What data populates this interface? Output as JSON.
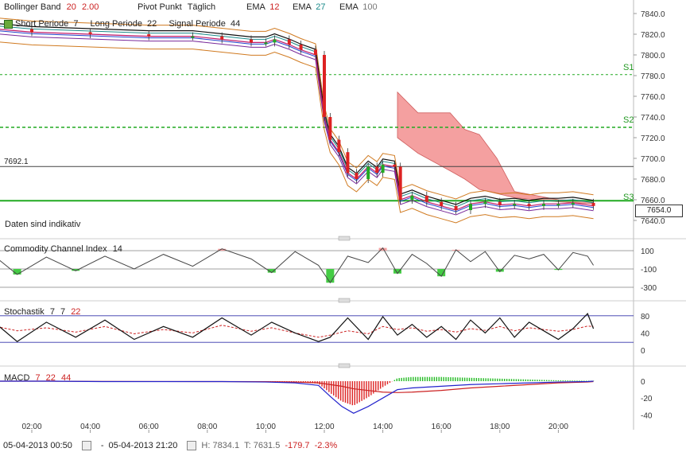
{
  "legend": {
    "bollinger": {
      "label": "Bollinger Band",
      "p1": "20",
      "p2": "2.00"
    },
    "pivot": {
      "label": "Pivot Punkt",
      "mode": "Täglich"
    },
    "ema": [
      {
        "label": "EMA",
        "value": "12"
      },
      {
        "label": "EMA",
        "value": "27"
      },
      {
        "label": "EMA",
        "value": "100"
      }
    ],
    "ichimoku": {
      "short_label": "Short Periode",
      "short_value": "7",
      "long_label": "Long Periode",
      "long_value": "22",
      "signal_label": "Signal Periode",
      "signal_value": "44"
    }
  },
  "main": {
    "note": "Daten sind indikativ",
    "level_label": "7692.1",
    "current_price": "7654.0",
    "pivot_labels": {
      "s1": "S1",
      "s2": "S2",
      "s3": "S3"
    }
  },
  "panels": {
    "cci": {
      "label": "Commodity Channel Index",
      "period": "14",
      "ticks": [
        "100",
        "-100",
        "-300"
      ]
    },
    "stoch": {
      "label": "Stochastik",
      "k": "7",
      "d": "7",
      "slow": "22",
      "ticks": [
        "80",
        "40",
        "0"
      ]
    },
    "macd": {
      "label": "MACD",
      "fast": "7",
      "slow": "22",
      "signal": "44",
      "ticks": [
        "0",
        "-20",
        "-40"
      ]
    }
  },
  "footer": {
    "start": "05-04-2013 00:50",
    "sep": "-",
    "end": "05-04-2013 21:20",
    "high": "H: 7834.1",
    "low": "T: 7631.5",
    "change": "-179.7",
    "change_pct": "-2.3%"
  },
  "colors": {
    "candle_up": "#22aa22",
    "candle_down": "#dd2222",
    "cloud": "#f08080",
    "pivot_line": "#22aa22",
    "cci_pos": "#f4a0a0",
    "cci_neg": "#44cc44",
    "macd_line": "#2222cc",
    "signal_line": "#cc2222"
  },
  "chart_data": [
    {
      "type": "line",
      "title": "",
      "x_tick_labels": [
        "02:00",
        "04:00",
        "06:00",
        "08:00",
        "10:00",
        "12:00",
        "14:00",
        "16:00",
        "18:00",
        "20:00"
      ],
      "x_tick_hours": [
        2,
        4,
        6,
        8,
        10,
        12,
        14,
        16,
        18,
        20
      ],
      "y_tick_labels": [
        "7840.0",
        "7820.0",
        "7800.0",
        "7780.0",
        "7760.0",
        "7740.0",
        "7720.0",
        "7700.0",
        "7680.0",
        "7660.0",
        "7640.0"
      ],
      "ylim": [
        7630,
        7850
      ],
      "reference_lines": {
        "S1": 7781,
        "S2": 7730,
        "S3": 7659,
        "level": 7692.1
      },
      "price_series": {
        "name": "",
        "x_hours": [
          0.8,
          2,
          4,
          6,
          7.5,
          8.5,
          9.5,
          10,
          10.3,
          10.8,
          11.2,
          11.7,
          12.0,
          12.2,
          12.5,
          12.8,
          13.1,
          13.5,
          13.8,
          14.0,
          14.4,
          14.6,
          15.0,
          15.5,
          16.0,
          16.5,
          17.0,
          17.5,
          18.0,
          18.5,
          19.0,
          19.5,
          20.0,
          20.5,
          21.2
        ],
        "values": [
          7825,
          7822,
          7820,
          7818,
          7818,
          7815,
          7812,
          7812,
          7815,
          7810,
          7805,
          7800,
          7740,
          7718,
          7706,
          7686,
          7680,
          7692,
          7686,
          7694,
          7692,
          7660,
          7664,
          7658,
          7654,
          7650,
          7656,
          7658,
          7655,
          7656,
          7654,
          7656,
          7656,
          7657,
          7654
        ]
      },
      "cloud": {
        "x_hours": [
          14.5,
          15.2,
          16.3,
          16.8,
          17.3,
          17.9,
          18.5,
          20.0,
          21.2
        ],
        "upper": [
          7764,
          7744,
          7744,
          7728,
          7723,
          7700,
          7668,
          7660,
          7659
        ],
        "lower": [
          7720,
          7705,
          7688,
          7680,
          7670,
          7666,
          7662,
          7658,
          7656
        ]
      }
    },
    {
      "type": "line",
      "title": "Commodity Channel Index 14",
      "y_tick_labels": [
        "100",
        "-100",
        "-300"
      ],
      "ylim": [
        -350,
        180
      ],
      "x_hours": [
        0.8,
        1.5,
        2.5,
        3.5,
        4.5,
        5.5,
        6.5,
        7.5,
        8.5,
        9.5,
        10.2,
        11.0,
        11.8,
        12.2,
        12.8,
        13.5,
        14.0,
        14.5,
        15.0,
        15.5,
        16.0,
        16.5,
        17.0,
        17.5,
        18.0,
        18.5,
        19.0,
        19.5,
        20.0,
        20.5,
        21.0,
        21.2
      ],
      "values": [
        20,
        -160,
        30,
        -120,
        40,
        -100,
        60,
        -70,
        120,
        10,
        -140,
        90,
        -60,
        -250,
        40,
        -30,
        130,
        -150,
        60,
        -40,
        -180,
        110,
        -20,
        90,
        -130,
        50,
        10,
        60,
        -110,
        80,
        40,
        -60
      ]
    },
    {
      "type": "line",
      "title": "Stochastik 7 7 22",
      "y_tick_labels": [
        "80",
        "40",
        "0"
      ],
      "ylim": [
        0,
        90
      ],
      "x_hours": [
        0.8,
        1.5,
        2.5,
        3.5,
        4.5,
        5.5,
        6.5,
        7.5,
        8.5,
        9.5,
        10.2,
        11.0,
        11.8,
        12.2,
        12.8,
        13.5,
        14.0,
        14.5,
        15.0,
        15.5,
        16.0,
        16.5,
        17.0,
        17.5,
        18.0,
        18.5,
        19.0,
        19.5,
        20.0,
        20.5,
        21.0,
        21.2
      ],
      "series": [
        {
          "name": "",
          "values": [
            60,
            20,
            65,
            30,
            70,
            25,
            55,
            30,
            75,
            35,
            65,
            40,
            20,
            30,
            75,
            25,
            78,
            35,
            60,
            30,
            55,
            25,
            70,
            40,
            75,
            30,
            65,
            45,
            25,
            50,
            85,
            50
          ]
        },
        {
          "name": "",
          "values": [
            55,
            45,
            52,
            42,
            55,
            38,
            48,
            40,
            58,
            44,
            52,
            40,
            30,
            35,
            45,
            38,
            55,
            48,
            52,
            44,
            48,
            42,
            50,
            46,
            55,
            45,
            52,
            48,
            44,
            48,
            56,
            55
          ]
        }
      ]
    },
    {
      "type": "bar",
      "title": "MACD 7 22 44",
      "y_tick_labels": [
        "0",
        "-20",
        "-40"
      ],
      "ylim": [
        -45,
        8
      ],
      "x_hours": [
        0.8,
        2.5,
        4.5,
        6.5,
        8.5,
        10.0,
        11.0,
        11.8,
        12.2,
        12.6,
        13.0,
        13.5,
        14.0,
        14.5,
        15.0,
        16.0,
        17.0,
        18.0,
        19.0,
        20.0,
        21.0,
        21.2
      ],
      "series": [
        {
          "name": "",
          "values": [
            0,
            0,
            -0.5,
            -0.5,
            -0.5,
            -1,
            -2,
            -5,
            -18,
            -30,
            -38,
            -30,
            -20,
            -10,
            -8,
            -6,
            -4,
            -3,
            -2,
            -1,
            -0.5,
            0
          ]
        },
        {
          "name": "",
          "values": [
            0,
            0,
            -0.3,
            -0.4,
            -0.5,
            -0.6,
            -1,
            -2,
            -4,
            -6,
            -9,
            -11,
            -13,
            -13.5,
            -13,
            -11,
            -8,
            -6,
            -4,
            -2,
            -1,
            -0.5
          ]
        }
      ]
    }
  ]
}
